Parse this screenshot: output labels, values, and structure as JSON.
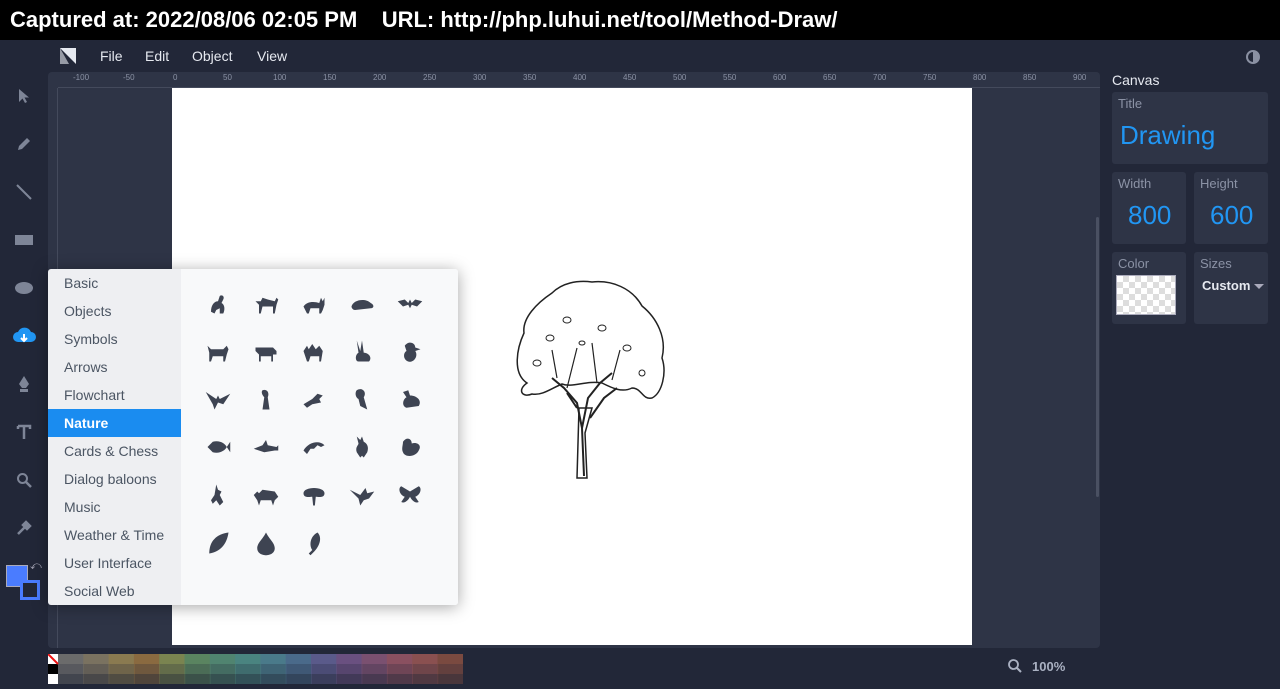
{
  "capture": {
    "text": "Captured at: 2022/08/06 02:05 PM    URL: http://php.luhui.net/tool/Method-Draw/"
  },
  "menu": {
    "items": [
      "File",
      "Edit",
      "Object",
      "View"
    ]
  },
  "ruler": {
    "top_labels": [
      "-100",
      "-50",
      "0",
      "50",
      "100",
      "150",
      "200",
      "250",
      "300",
      "350",
      "400",
      "450",
      "500",
      "550",
      "600",
      "650",
      "700",
      "750",
      "800",
      "850",
      "900"
    ]
  },
  "library": {
    "categories": [
      "Basic",
      "Objects",
      "Symbols",
      "Arrows",
      "Flowchart",
      "Nature",
      "Cards & Chess",
      "Dialog baloons",
      "Music",
      "Weather & Time",
      "User Interface",
      "Social Web"
    ],
    "active": "Nature",
    "shapes": [
      "monkey-icon",
      "dog-icon",
      "cat-icon",
      "mouse-icon",
      "bat-icon",
      "ox-icon",
      "cow-icon",
      "camel-icon",
      "rabbit-icon",
      "chick-icon",
      "eagle-icon",
      "penguin-icon",
      "crow-icon",
      "parrot-icon",
      "duck-icon",
      "fish-icon",
      "shark-icon",
      "dolphin-icon",
      "rooster-icon",
      "hen-icon",
      "unicorn-icon",
      "rhino-icon",
      "tree-icon",
      "dove-icon",
      "butterfly-icon",
      "leaf-icon",
      "drop-icon",
      "feather-icon"
    ]
  },
  "panel": {
    "title": "Canvas",
    "doc_title_label": "Title",
    "doc_title_value": "Drawing",
    "width_label": "Width",
    "width_value": "800",
    "height_label": "Height",
    "height_value": "600",
    "color_label": "Color",
    "sizes_label": "Sizes",
    "sizes_value": "Custom"
  },
  "colors": {
    "accent": "#1a8cf0",
    "fill": "#4a7cff",
    "app_bg": "#222738",
    "work_bg": "#2e3446",
    "value_text": "#2196f3"
  },
  "zoom": {
    "value": "100%"
  }
}
